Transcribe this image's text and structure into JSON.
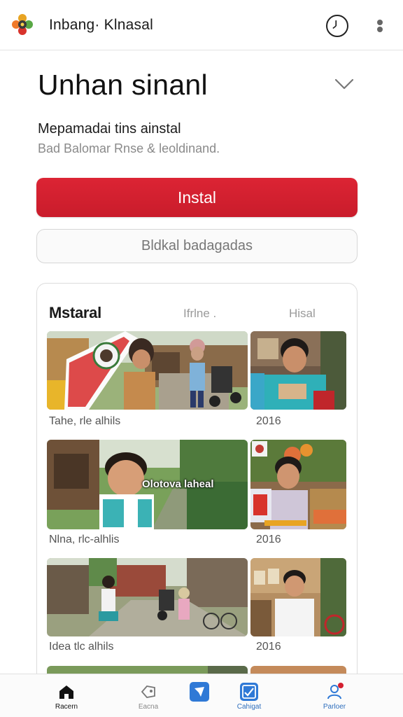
{
  "topbar": {
    "title": "Inbang· Klnasal",
    "logo_icon": "flower-logo-icon",
    "clock_icon": "clock-icon",
    "menu_icon": "more-vertical-icon"
  },
  "header": {
    "title": "Unhan sinanl",
    "subtitle": "Mepamadai tins ainstal",
    "subline": "Bad Balomar Rnse & leoldinand."
  },
  "actions": {
    "install_label": "Instal",
    "secondary_label": "Bldkal badagadas"
  },
  "gallery": {
    "heading": "Mstaral",
    "tabs": [
      "Ifrlne .",
      "Hisal"
    ],
    "rows": [
      {
        "caption": "Tahe, rle alhils",
        "year": "2016"
      },
      {
        "caption": "Nlna, rlc-alhlis",
        "year": "2016"
      },
      {
        "caption": "Idea tlc alhils",
        "year": "2016"
      }
    ],
    "overlay_text": "Olotova laheal"
  },
  "bottom_nav": {
    "items": [
      {
        "label": "Racern",
        "icon": "home-icon"
      },
      {
        "label": "Eacna",
        "icon": "tag-icon"
      },
      {
        "label": "",
        "icon": "send-icon"
      },
      {
        "label": "Cahigat",
        "icon": "image-check-icon"
      },
      {
        "label": "Parloer",
        "icon": "profile-icon"
      }
    ]
  },
  "colors": {
    "accent": "#d42030",
    "nav_blue": "#2f79d6",
    "text_muted": "#8a8a8a"
  }
}
